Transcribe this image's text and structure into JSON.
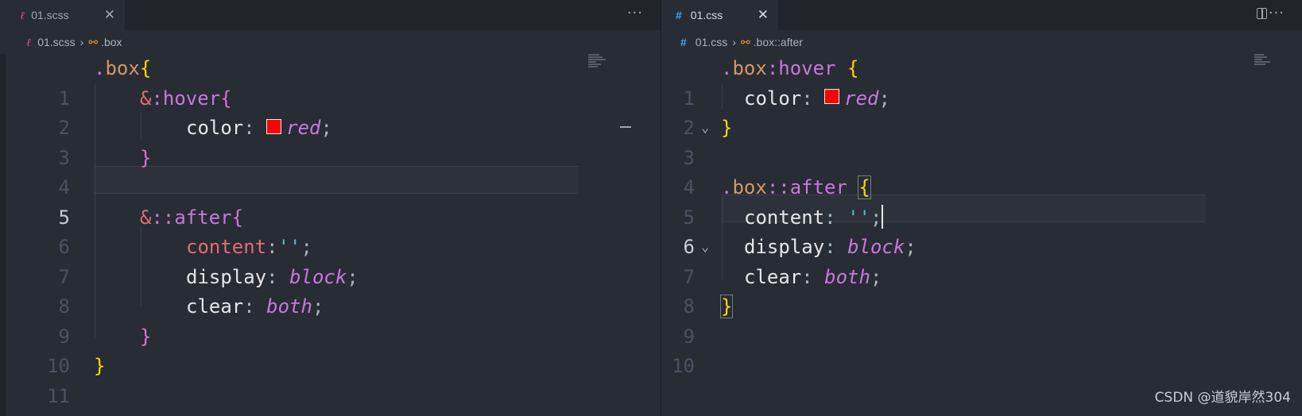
{
  "left": {
    "tab": {
      "icon": "sass-file-icon",
      "filename": "01.scss",
      "close": "✕"
    },
    "actions": "···",
    "breadcrumb": {
      "file": "01.scss",
      "symbol": ".box"
    },
    "active_line": "5",
    "lines": [
      {
        "n": "1"
      },
      {
        "n": "2"
      },
      {
        "n": "3"
      },
      {
        "n": "4"
      },
      {
        "n": "5"
      },
      {
        "n": "6"
      },
      {
        "n": "7"
      },
      {
        "n": "8"
      },
      {
        "n": "9"
      },
      {
        "n": "10"
      },
      {
        "n": "11"
      }
    ],
    "code": {
      "l1_dot": ".",
      "l1_sel": "box",
      "l1_open": "{",
      "l2_amp": "&",
      "l2_pseudo": ":hover",
      "l2_open": "{",
      "l3_prop": "color",
      "l3_colon": ": ",
      "l3_val": "red",
      "l3_semi": ";",
      "l4_close": "}",
      "l6_amp": "&",
      "l6_pseudo": "::after",
      "l6_open": "{",
      "l7_prop": "content",
      "l7_colon": ":",
      "l7_str": "''",
      "l7_semi": ";",
      "l8_prop": "display",
      "l8_colon": ": ",
      "l8_val": "block",
      "l8_semi": ";",
      "l9_prop": "clear",
      "l9_colon": ": ",
      "l9_val": "both",
      "l9_semi": ";",
      "l10_close": "}",
      "l11_close": "}"
    }
  },
  "right": {
    "tab": {
      "icon": "css-file-icon",
      "filename": "01.css",
      "close": "✕"
    },
    "actions": "···",
    "breadcrumb": {
      "file": "01.css",
      "symbol": ".box::after"
    },
    "active_line": "6",
    "lines": [
      {
        "n": "1"
      },
      {
        "n": "2"
      },
      {
        "n": "3"
      },
      {
        "n": "4"
      },
      {
        "n": "5"
      },
      {
        "n": "6"
      },
      {
        "n": "7"
      },
      {
        "n": "8"
      },
      {
        "n": "9"
      },
      {
        "n": "10"
      }
    ],
    "code": {
      "l1_dot": ".",
      "l1_sel": "box",
      "l1_pseudo": ":hover",
      "l1_open": "{",
      "l2_prop": "color",
      "l2_colon": ": ",
      "l2_val": "red",
      "l2_semi": ";",
      "l3_close": "}",
      "l5_dot": ".",
      "l5_sel": "box",
      "l5_pseudo": "::after",
      "l5_open": "{",
      "l6_prop": "content",
      "l6_colon": ": ",
      "l6_str": "''",
      "l6_semi": ";",
      "l7_prop": "display",
      "l7_colon": ": ",
      "l7_val": "block",
      "l7_semi": ";",
      "l8_prop": "clear",
      "l8_colon": ": ",
      "l8_val": "both",
      "l8_semi": ";",
      "l9_close": "}"
    }
  },
  "watermark": "CSDN @道貌岸然304",
  "colors": {
    "swatch": "#ff0000",
    "background": "#282c34",
    "tabbar": "#21252b"
  }
}
